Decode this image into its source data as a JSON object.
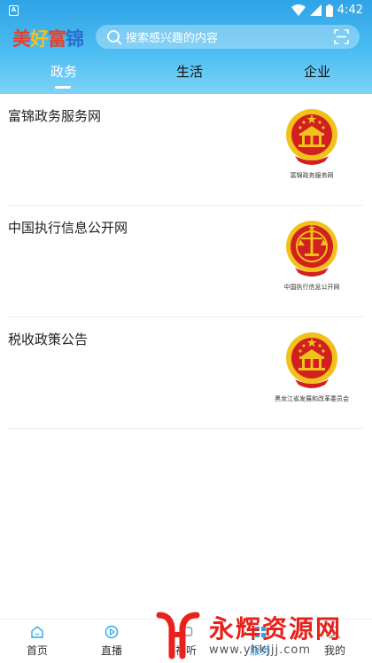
{
  "status_bar": {
    "time": "4:42",
    "indicator_letter": "A"
  },
  "header": {
    "logo_chars": [
      "美",
      "好",
      "富",
      "锦"
    ],
    "search_placeholder": "搜索感兴趣的内容"
  },
  "tabs": [
    {
      "label": "政务",
      "active": true
    },
    {
      "label": "生活",
      "active": false
    },
    {
      "label": "企业",
      "active": false
    }
  ],
  "items": [
    {
      "title": "富锦政务服务网",
      "caption": "富锦政务服务网",
      "emblem": "national-emblem"
    },
    {
      "title": "中国执行信息公开网",
      "caption": "中国执行信息公开网",
      "emblem": "court-emblem"
    },
    {
      "title": "税收政策公告",
      "caption": "黑龙江省发展和改革委员会",
      "emblem": "national-emblem"
    }
  ],
  "bottom_nav": [
    {
      "label": "首页",
      "icon": "home-icon"
    },
    {
      "label": "直播",
      "icon": "play-icon"
    },
    {
      "label": "视听",
      "icon": "tv-icon"
    },
    {
      "label": "服务",
      "icon": "service-icon",
      "active": true
    },
    {
      "label": "我的",
      "icon": "user-icon"
    }
  ],
  "watermark": {
    "text": "永辉资源网",
    "url": "www.yhkjjj.com"
  },
  "colors": {
    "accent": "#2fa4e6",
    "emblem_red": "#d21f1f",
    "emblem_gold": "#f2c11c"
  }
}
